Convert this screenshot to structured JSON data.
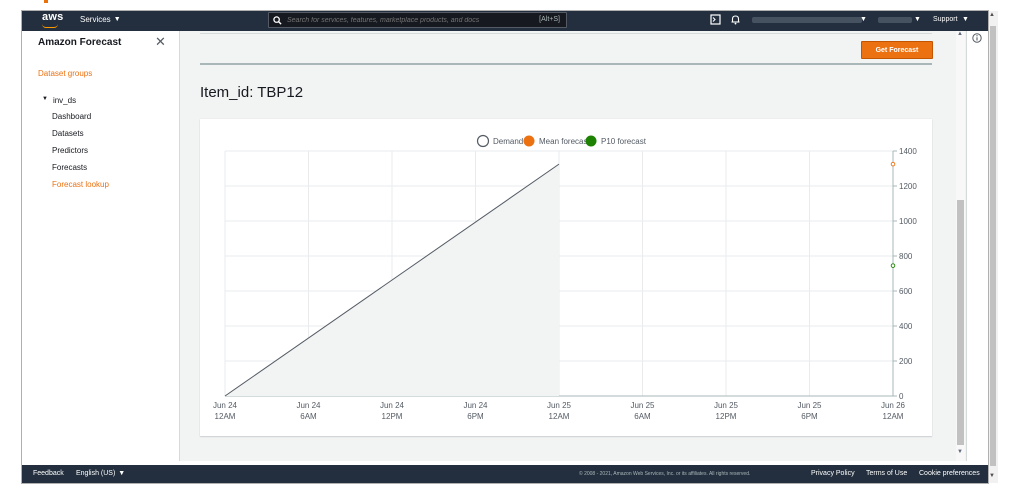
{
  "nav": {
    "logo_text": "aws",
    "services_label": "Services",
    "search_placeholder": "Search for services, features, marketplace products, and docs",
    "search_shortcut": "[Alt+S]",
    "support_label": "Support",
    "icons": [
      "cloudshell-icon",
      "bell-icon"
    ],
    "brand_dark": "#232f3e",
    "accent": "#ff9900"
  },
  "sidebar": {
    "title": "Amazon Forecast",
    "top_link": "Dataset groups",
    "group_label": "inv_ds",
    "items": [
      {
        "label": "Dashboard",
        "active": false
      },
      {
        "label": "Datasets",
        "active": false
      },
      {
        "label": "Predictors",
        "active": false
      },
      {
        "label": "Forecasts",
        "active": false
      },
      {
        "label": "Forecast lookup",
        "active": true
      }
    ]
  },
  "main": {
    "button_label": "Get Forecast",
    "item_title": "Item_id: TBP12",
    "button_color": "#ec7211"
  },
  "footer": {
    "feedback": "Feedback",
    "language": "English (US)",
    "copyright": "© 2008 - 2021, Amazon Web Services, Inc. or its affiliates. All rights reserved.",
    "links": [
      "Privacy Policy",
      "Terms of Use",
      "Cookie preferences"
    ]
  },
  "chart_data": {
    "type": "line",
    "legend": [
      {
        "name": "Demand",
        "color": "#545b64",
        "style": "hollow"
      },
      {
        "name": "Mean forecast",
        "color": "#ec7211",
        "style": "filled"
      },
      {
        "name": "P10 forecast",
        "color": "#1d8102",
        "style": "filled"
      }
    ],
    "legend_placement": "top-center",
    "x_ticks": [
      {
        "line1": "Jun 24",
        "line2": "12AM"
      },
      {
        "line1": "Jun 24",
        "line2": "6AM"
      },
      {
        "line1": "Jun 24",
        "line2": "12PM"
      },
      {
        "line1": "Jun 24",
        "line2": "6PM"
      },
      {
        "line1": "Jun 25",
        "line2": "12AM"
      },
      {
        "line1": "Jun 25",
        "line2": "6AM"
      },
      {
        "line1": "Jun 25",
        "line2": "12PM"
      },
      {
        "line1": "Jun 25",
        "line2": "6PM"
      },
      {
        "line1": "Jun 26",
        "line2": "12AM"
      }
    ],
    "x_range_hours": [
      0,
      48
    ],
    "y_ticks": [
      "1400",
      "1200",
      "1000",
      "800",
      "600",
      "400",
      "200",
      "0"
    ],
    "ylim": [
      0,
      1400
    ],
    "y_axis_side": "right",
    "grid": true,
    "series": [
      {
        "name": "Demand",
        "color": "#545b64",
        "area": true,
        "points": [
          {
            "x": 0,
            "y": 0
          },
          {
            "x": 24,
            "y": 1325
          }
        ]
      },
      {
        "name": "Mean forecast",
        "color": "#ec7211",
        "points": [
          {
            "x": 48,
            "y": 1325
          }
        ]
      },
      {
        "name": "P10 forecast",
        "color": "#1d8102",
        "points": [
          {
            "x": 48,
            "y": 745
          }
        ]
      }
    ]
  }
}
